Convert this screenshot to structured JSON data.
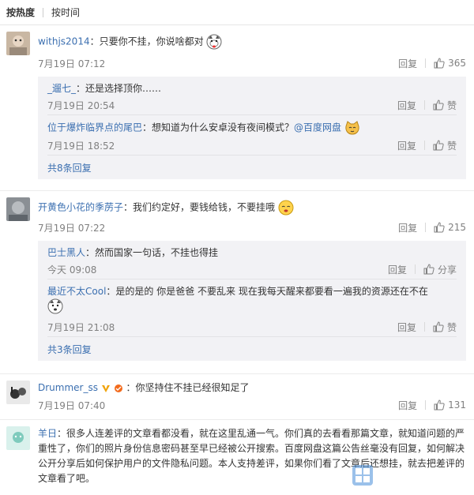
{
  "tabs": {
    "hot": "按热度",
    "time": "按时间"
  },
  "actions": {
    "reply": "回复",
    "like_text": "赞"
  },
  "comments": [
    {
      "user": "withjs2014",
      "text": "：只要你不挂，你说啥都对",
      "time": "7月19日 07:12",
      "likes": "365",
      "replies": [
        {
          "user": "_遛七_",
          "text": "：还是选择顶你……",
          "time": "7月19日 20:54",
          "like": "赞"
        },
        {
          "user": "位于爆炸临界点的尾巴",
          "text": "：想知道为什么安卓没有夜间模式？",
          "mention": "@百度网盘",
          "time": "7月19日 18:52",
          "like": "赞"
        }
      ],
      "more": "共8条回复"
    },
    {
      "user": "开黄色小花的季苈子",
      "text": "：我们约定好，要钱给钱，不要挂哦",
      "time": "7月19日 07:22",
      "likes": "215",
      "replies": [
        {
          "user": "巴士黑人",
          "text": "：然而国家一句话，不挂也得挂",
          "time": "今天 09:08",
          "like": "分享"
        },
        {
          "user": "最近不太Cool",
          "text": "：是的是的 你是爸爸 不要乱来 现在我每天醒来都要看一遍我的资源还在不在",
          "time": "7月19日 21:08",
          "like": "赞"
        }
      ],
      "more": "共3条回复"
    },
    {
      "user": "Drummer_ss",
      "text": "：你坚持住不挂已经很知足了",
      "time": "7月19日 07:40",
      "likes": "131"
    },
    {
      "user": "羊日",
      "text": "：很多人连差评的文章看都没看，就在这里乱通一气。你们真的去看看那篇文章，就知道问题的严重性了，你们的照片身份信息密码甚至早已经被公开搜索。百度网盘这篇公告丝毫没有回复，如何解决公开分享后如何保护用户的文件隐私问题。本人支持差评，如果你们看了文章后还想挂，就去把差评的文章看了吧。"
    }
  ],
  "watermark": "Win7系统之家"
}
